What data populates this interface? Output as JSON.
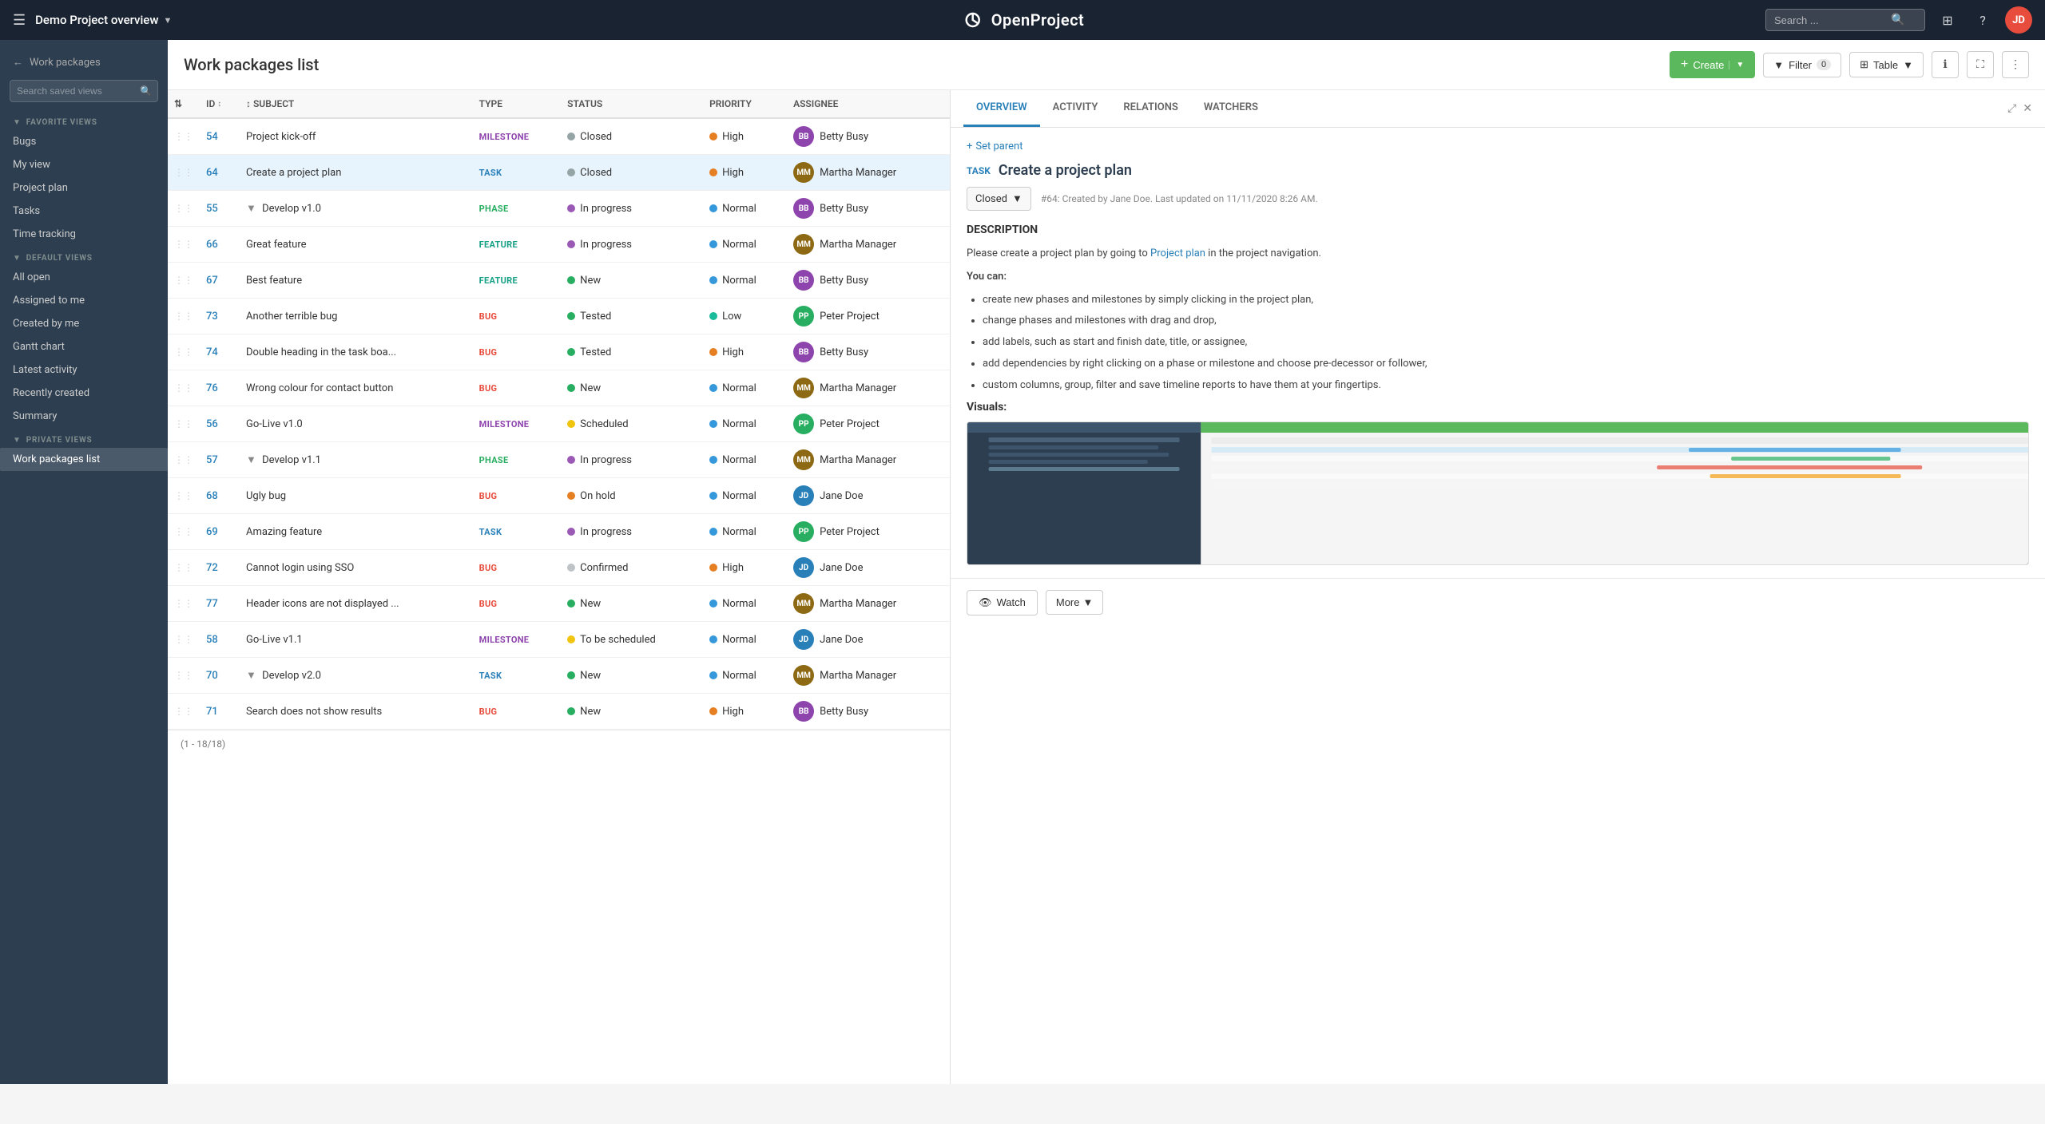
{
  "topnav": {
    "hamburger": "☰",
    "project_name": "Demo Project overview",
    "chevron": "▼",
    "logo_text": "OpenProject",
    "search_placeholder": "Search ...",
    "grid_icon": "⊞",
    "help_icon": "?",
    "avatar_initials": "JD"
  },
  "sidebar": {
    "back_label": "Work packages",
    "search_placeholder": "Search saved views",
    "sections": [
      {
        "label": "FAVORITE VIEWS",
        "items": [
          "Bugs",
          "My view",
          "Project plan",
          "Tasks",
          "Time tracking"
        ]
      },
      {
        "label": "DEFAULT VIEWS",
        "items": [
          "All open",
          "Assigned to me",
          "Created by me",
          "Gantt chart",
          "Latest activity",
          "Recently created",
          "Summary"
        ]
      },
      {
        "label": "PRIVATE VIEWS",
        "items": [
          "Work packages list"
        ]
      }
    ]
  },
  "main": {
    "title": "Work packages list",
    "create_label": "Create",
    "filter_label": "Filter",
    "filter_count": "0",
    "table_label": "Table",
    "footer": "(1 - 18/18)"
  },
  "table": {
    "columns": [
      "ID",
      "SUBJECT",
      "TYPE",
      "STATUS",
      "PRIORITY",
      "ASSIGNEE"
    ],
    "rows": [
      {
        "id": "54",
        "subject": "Project kick-off",
        "type": "MILESTONE",
        "type_class": "type-milestone",
        "status": "Closed",
        "status_class": "status-closed",
        "priority": "High",
        "priority_class": "priority-high",
        "assignee": "Betty Busy",
        "assignee_initials": "BB",
        "assignee_class": "av-bb"
      },
      {
        "id": "64",
        "subject": "Create a project plan",
        "type": "TASK",
        "type_class": "type-task",
        "status": "Closed",
        "status_class": "status-closed",
        "priority": "High",
        "priority_class": "priority-high",
        "assignee": "Martha Manager",
        "assignee_initials": "MM",
        "assignee_class": "av-mm",
        "selected": true
      },
      {
        "id": "55",
        "subject": "Develop v1.0",
        "type": "PHASE",
        "type_class": "type-phase",
        "status": "In progress",
        "status_class": "status-inprogress",
        "priority": "Normal",
        "priority_class": "priority-normal",
        "assignee": "Betty Busy",
        "assignee_initials": "BB",
        "assignee_class": "av-bb",
        "expanded": true
      },
      {
        "id": "66",
        "subject": "Great feature",
        "type": "FEATURE",
        "type_class": "type-feature",
        "status": "In progress",
        "status_class": "status-inprogress",
        "priority": "Normal",
        "priority_class": "priority-normal",
        "assignee": "Martha Manager",
        "assignee_initials": "MM",
        "assignee_class": "av-mm"
      },
      {
        "id": "67",
        "subject": "Best feature",
        "type": "FEATURE",
        "type_class": "type-feature",
        "status": "New",
        "status_class": "status-new",
        "priority": "Normal",
        "priority_class": "priority-normal",
        "assignee": "Betty Busy",
        "assignee_initials": "BB",
        "assignee_class": "av-bb"
      },
      {
        "id": "73",
        "subject": "Another terrible bug",
        "type": "BUG",
        "type_class": "type-bug",
        "status": "Tested",
        "status_class": "status-tested",
        "priority": "Low",
        "priority_class": "priority-low",
        "assignee": "Peter Project",
        "assignee_initials": "PP",
        "assignee_class": "av-pp"
      },
      {
        "id": "74",
        "subject": "Double heading in the task boa...",
        "type": "BUG",
        "type_class": "type-bug",
        "status": "Tested",
        "status_class": "status-tested",
        "priority": "High",
        "priority_class": "priority-high",
        "assignee": "Betty Busy",
        "assignee_initials": "BB",
        "assignee_class": "av-bb"
      },
      {
        "id": "76",
        "subject": "Wrong colour for contact button",
        "type": "BUG",
        "type_class": "type-bug",
        "status": "New",
        "status_class": "status-new",
        "priority": "Normal",
        "priority_class": "priority-normal",
        "assignee": "Martha Manager",
        "assignee_initials": "MM",
        "assignee_class": "av-mm"
      },
      {
        "id": "56",
        "subject": "Go-Live v1.0",
        "type": "MILESTONE",
        "type_class": "type-milestone",
        "status": "Scheduled",
        "status_class": "status-scheduled",
        "priority": "Normal",
        "priority_class": "priority-normal",
        "assignee": "Peter Project",
        "assignee_initials": "PP",
        "assignee_class": "av-pp"
      },
      {
        "id": "57",
        "subject": "Develop v1.1",
        "type": "PHASE",
        "type_class": "type-phase",
        "status": "In progress",
        "status_class": "status-inprogress",
        "priority": "Normal",
        "priority_class": "priority-normal",
        "assignee": "Martha Manager",
        "assignee_initials": "MM",
        "assignee_class": "av-mm",
        "expanded": true
      },
      {
        "id": "68",
        "subject": "Ugly bug",
        "type": "BUG",
        "type_class": "type-bug",
        "status": "On hold",
        "status_class": "status-onhold",
        "priority": "Normal",
        "priority_class": "priority-normal",
        "assignee": "Jane Doe",
        "assignee_initials": "JD",
        "assignee_class": "av-jd"
      },
      {
        "id": "69",
        "subject": "Amazing feature",
        "type": "TASK",
        "type_class": "type-task",
        "status": "In progress",
        "status_class": "status-inprogress",
        "priority": "Normal",
        "priority_class": "priority-normal",
        "assignee": "Peter Project",
        "assignee_initials": "PP",
        "assignee_class": "av-pp"
      },
      {
        "id": "72",
        "subject": "Cannot login using SSO",
        "type": "BUG",
        "type_class": "type-bug",
        "status": "Confirmed",
        "status_class": "status-confirmed",
        "priority": "High",
        "priority_class": "priority-high",
        "assignee": "Jane Doe",
        "assignee_initials": "JD",
        "assignee_class": "av-jd"
      },
      {
        "id": "77",
        "subject": "Header icons are not displayed ...",
        "type": "BUG",
        "type_class": "type-bug",
        "status": "New",
        "status_class": "status-new",
        "priority": "Normal",
        "priority_class": "priority-normal",
        "assignee": "Martha Manager",
        "assignee_initials": "MM",
        "assignee_class": "av-mm"
      },
      {
        "id": "58",
        "subject": "Go-Live v1.1",
        "type": "MILESTONE",
        "type_class": "type-milestone",
        "status": "To be scheduled",
        "status_class": "status-tobesched",
        "priority": "Normal",
        "priority_class": "priority-normal",
        "assignee": "Jane Doe",
        "assignee_initials": "JD",
        "assignee_class": "av-jd"
      },
      {
        "id": "70",
        "subject": "Develop v2.0",
        "type": "TASK",
        "type_class": "type-task",
        "status": "New",
        "status_class": "status-new",
        "priority": "Normal",
        "priority_class": "priority-normal",
        "assignee": "Martha Manager",
        "assignee_initials": "MM",
        "assignee_class": "av-mm",
        "expanded": true
      },
      {
        "id": "71",
        "subject": "Search does not show results",
        "type": "BUG",
        "type_class": "type-bug",
        "status": "New",
        "status_class": "status-new",
        "priority": "High",
        "priority_class": "priority-high",
        "assignee": "Betty Busy",
        "assignee_initials": "BB",
        "assignee_class": "av-bb"
      }
    ]
  },
  "detail": {
    "tabs": [
      "OVERVIEW",
      "ACTIVITY",
      "RELATIONS",
      "WATCHERS"
    ],
    "active_tab": "OVERVIEW",
    "set_parent": "+ Set parent",
    "type_badge": "TASK",
    "title": "Create a project plan",
    "status": "Closed",
    "meta": "#64: Created by Jane Doe. Last updated on 11/11/2020 8:26 AM.",
    "description_title": "DESCRIPTION",
    "description_intro": "Please create a project plan by going to",
    "description_link": "Project plan",
    "description_middle": "in the project navigation.",
    "you_can": "You can:",
    "bullets": [
      "create new phases and milestones by simply clicking in the project plan,",
      "change phases and milestones with drag and drop,",
      "add labels, such as start and finish date, title, or assignee,",
      "add dependencies by right clicking on a phase or milestone and choose pre-decessor or follower,",
      "custom columns, group, filter and save timeline reports to have them at your fingertips."
    ],
    "visuals_title": "Visuals:",
    "watch_label": "Watch",
    "more_label": "More"
  }
}
